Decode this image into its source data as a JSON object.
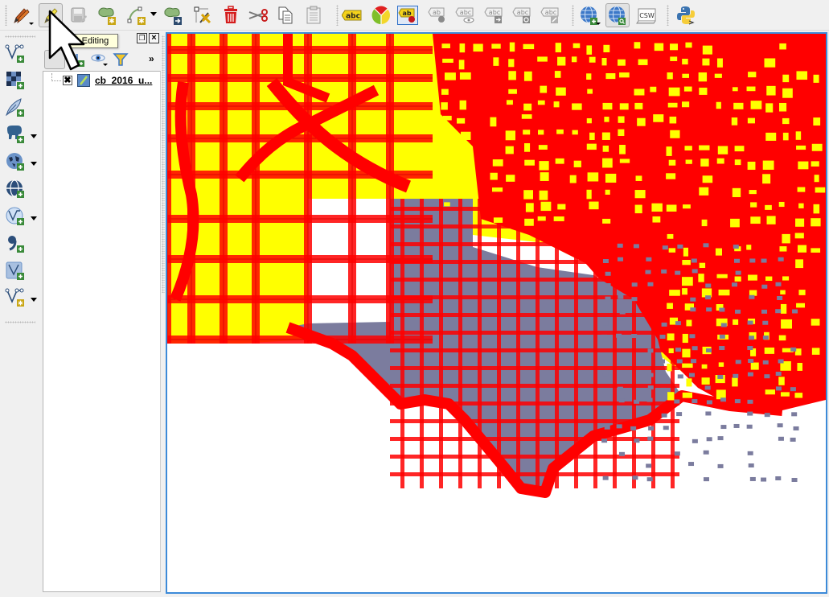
{
  "toolbar": {
    "items": [
      {
        "name": "current-edits-button",
        "icon": "pencils-icon",
        "has_dropdown": true
      },
      {
        "name": "toggle-editing-button",
        "icon": "pencil-icon",
        "pressed": true
      },
      {
        "name": "save-layer-edits-button",
        "icon": "save-edits-icon",
        "disabled": true
      },
      {
        "name": "add-feature-button",
        "icon": "add-polygon-icon"
      },
      {
        "name": "vertex-tool-button",
        "icon": "vertex-tool-icon",
        "has_dropdown": true
      },
      {
        "name": "move-feature-button",
        "icon": "move-feature-icon"
      },
      {
        "name": "node-tool-button",
        "icon": "node-tool-icon"
      },
      {
        "name": "delete-selected-button",
        "icon": "trash-icon"
      },
      {
        "name": "cut-features-button",
        "icon": "scissors-icon"
      },
      {
        "name": "copy-features-button",
        "icon": "copy-icon"
      },
      {
        "name": "paste-features-button",
        "icon": "paste-icon"
      },
      {
        "name": "layer-labeling-button",
        "icon": "label-abc-icon",
        "text": "abc"
      },
      {
        "name": "layer-diagram-button",
        "icon": "diagram-pie-icon"
      },
      {
        "name": "pin-labels-button",
        "icon": "pin-label-icon",
        "text": "ab"
      },
      {
        "name": "highlight-pinned-labels-button",
        "icon": "label-pin-grey-icon",
        "text": "ab"
      },
      {
        "name": "show-hide-labels-button",
        "icon": "label-eye-icon",
        "text": "abc"
      },
      {
        "name": "move-label-button",
        "icon": "label-move-icon",
        "text": "abc"
      },
      {
        "name": "rotate-label-button",
        "icon": "label-rotate-icon",
        "text": "abc"
      },
      {
        "name": "change-label-button",
        "icon": "label-edit-icon",
        "text": "abc"
      },
      {
        "name": "add-wms-layer-button",
        "icon": "globe-add-icon",
        "has_dropdown": true
      },
      {
        "name": "metasearch-button",
        "icon": "globe-search-icon",
        "pressed": true
      },
      {
        "name": "csw-button",
        "icon": "csw-icon",
        "text": "CSW"
      },
      {
        "name": "python-console-button",
        "icon": "python-icon"
      }
    ]
  },
  "tooltip": {
    "text": "Toggle Editing",
    "visible_text": "le Editing"
  },
  "left_toolbar": {
    "items": [
      {
        "name": "add-vector-layer-button",
        "icon": "vector-add-icon"
      },
      {
        "name": "add-raster-layer-button",
        "icon": "raster-add-icon"
      },
      {
        "name": "add-spatialite-layer-button",
        "icon": "feather-add-icon"
      },
      {
        "name": "add-postgis-layer-button",
        "icon": "elephant-add-icon",
        "has_dropdown": true
      },
      {
        "name": "add-wms-wmts-layer-button",
        "icon": "globe-map-add-icon",
        "has_dropdown": true
      },
      {
        "name": "add-wcs-layer-button",
        "icon": "globe-add-icon"
      },
      {
        "name": "add-wfs-layer-button",
        "icon": "globe-vector-add-icon",
        "has_dropdown": true
      },
      {
        "name": "add-delimited-text-layer-button",
        "icon": "comma-add-icon"
      },
      {
        "name": "add-virtual-layer-button",
        "icon": "virtual-layer-add-icon"
      },
      {
        "name": "new-shapefile-layer-button",
        "icon": "vector-new-icon",
        "has_dropdown": true
      }
    ]
  },
  "layers_panel": {
    "tools": [
      {
        "name": "add-group-button",
        "icon": "add-group-icon"
      },
      {
        "name": "manage-visibility-button",
        "icon": "eye-icon"
      },
      {
        "name": "filter-legend-button",
        "icon": "filter-icon"
      },
      {
        "name": "more-tools-button",
        "icon": "chevron-right-double-icon",
        "text": "»"
      }
    ],
    "layers": [
      {
        "name": "cb_2016_u...",
        "checked": true,
        "icon": "polygon-layer-icon"
      }
    ]
  },
  "map": {
    "colors": {
      "background": "#ffffff",
      "polygon_fill": "#ffff00",
      "selected_fill": "#7b7c9e",
      "vertex_markers": "#ff0000",
      "boundary_lines": "#1a1a1a",
      "canvas_border": "#3c8ad8"
    }
  }
}
